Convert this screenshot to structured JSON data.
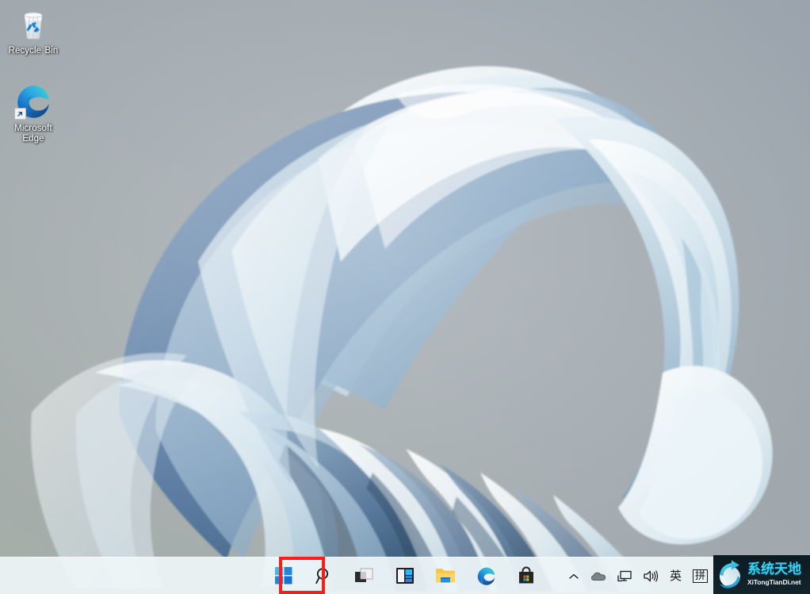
{
  "desktop": {
    "background_color": "#a0a8ac",
    "wallpaper_name": "windows-11-bloom-wallpaper",
    "icons": [
      {
        "id": "recycle-bin",
        "label": "Recycle Bin",
        "icon": "recycle-bin-icon",
        "shortcut": false
      },
      {
        "id": "microsoft-edge",
        "label": "Microsoft Edge",
        "icon": "microsoft-edge-icon",
        "shortcut": true
      }
    ]
  },
  "taskbar": {
    "background_color": "#eef5f7",
    "highlight_color": "#fc1c1c",
    "buttons": [
      {
        "id": "start",
        "label": "Start",
        "icon": "windows-start-icon",
        "highlighted": true
      },
      {
        "id": "search",
        "label": "Search",
        "icon": "search-icon",
        "highlighted": false
      },
      {
        "id": "task-view",
        "label": "Task View",
        "icon": "task-view-icon",
        "highlighted": false
      },
      {
        "id": "widgets",
        "label": "Widgets",
        "icon": "widgets-icon",
        "highlighted": false
      },
      {
        "id": "file-explorer",
        "label": "File Explorer",
        "icon": "file-explorer-icon",
        "highlighted": false
      },
      {
        "id": "microsoft-edge",
        "label": "Microsoft Edge",
        "icon": "microsoft-edge-icon",
        "highlighted": false
      },
      {
        "id": "microsoft-store",
        "label": "Microsoft Store",
        "icon": "microsoft-store-icon",
        "highlighted": false
      }
    ]
  },
  "tray": {
    "items": [
      {
        "id": "show-hidden-icons",
        "label": "Show hidden icons",
        "icon": "chevron-up-icon",
        "type": "icon"
      },
      {
        "id": "onedrive",
        "label": "OneDrive",
        "icon": "cloud-icon",
        "type": "icon"
      },
      {
        "id": "network",
        "label": "Network",
        "icon": "network-monitor-icon",
        "type": "icon"
      },
      {
        "id": "volume",
        "label": "Volume",
        "icon": "speaker-icon",
        "type": "icon"
      },
      {
        "id": "ime-language",
        "label": "英",
        "icon": "ime-language-icon",
        "type": "text"
      },
      {
        "id": "ime-mode",
        "label": "拼",
        "icon": "ime-pinyin-icon",
        "type": "boxed-text"
      }
    ]
  },
  "watermark": {
    "title_cn": "系统天地",
    "title_en": "XiTongTianDi.net",
    "accent_color": "#35d3f5"
  }
}
